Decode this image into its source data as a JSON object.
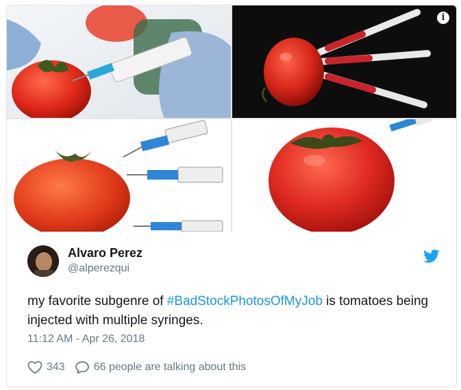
{
  "tweet": {
    "author_name": "Alvaro Perez",
    "author_handle": "@alperezqui",
    "text_prefix": "my favorite subgenre of ",
    "hashtag": "#BadStockPhotosOfMyJob",
    "text_suffix": " is tomatoes being injected with multiple syringes.",
    "timestamp": "11:12 AM - Apr 26, 2018",
    "likes": "343",
    "talking": "66 people are talking about this"
  },
  "media": {
    "info_icon": "i",
    "photos": [
      "tomato-syringe-gloved-hand",
      "tomato-three-syringes-dark",
      "tomato-three-syringes-white",
      "tomato-single-syringe"
    ]
  },
  "icons": {
    "heart": "heart-icon",
    "reply": "speech-bubble-icon",
    "brand": "twitter-bird-icon",
    "info": "info-icon"
  },
  "colors": {
    "accent": "#1b95e0",
    "text": "#14171a",
    "muted": "#657786",
    "border": "#dfe4ea",
    "tomato": "#d92a1a"
  }
}
